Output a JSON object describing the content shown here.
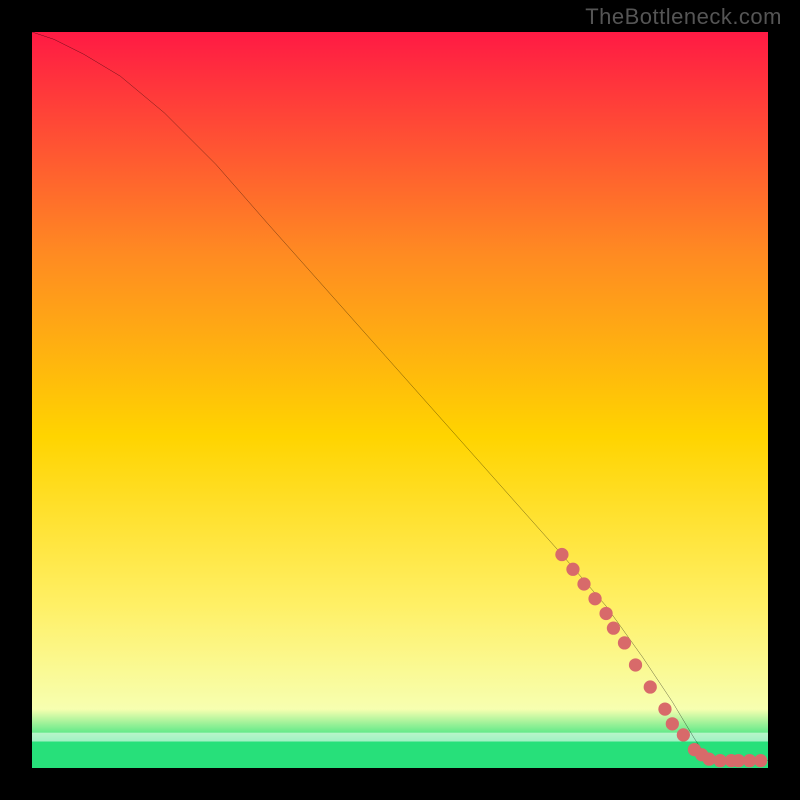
{
  "watermark": "TheBottleneck.com",
  "chart_data": {
    "type": "line",
    "title": "",
    "xlabel": "",
    "ylabel": "",
    "xlim": [
      0,
      100
    ],
    "ylim": [
      0,
      100
    ],
    "gradient_colors": {
      "top": "#ff1a44",
      "mid_upper": "#ff8a22",
      "mid": "#ffd400",
      "mid_lower": "#fff066",
      "lower": "#f7ffb0",
      "optimal": "#27e07a"
    },
    "series": [
      {
        "name": "bottleneck-curve",
        "stroke": "#000000",
        "x": [
          0,
          3,
          7,
          12,
          18,
          25,
          32,
          40,
          48,
          56,
          64,
          72,
          78,
          83,
          87,
          90,
          92,
          100
        ],
        "y": [
          100,
          99,
          97,
          94,
          89,
          82,
          74,
          65,
          56,
          47,
          38,
          29,
          22,
          15,
          9,
          4,
          1,
          1
        ]
      }
    ],
    "markers": {
      "name": "highlighted-region",
      "color": "#d86a6a",
      "radius": 6,
      "x": [
        72,
        73.5,
        75,
        76.5,
        78,
        79,
        80.5,
        82,
        84,
        86,
        87,
        88.5,
        90,
        91,
        92,
        93.5,
        95,
        96,
        97.5,
        99
      ],
      "y": [
        29,
        27,
        25,
        23,
        21,
        19,
        17,
        14,
        11,
        8,
        6,
        4.5,
        2.5,
        1.8,
        1.2,
        1,
        1,
        1,
        1,
        1
      ]
    }
  }
}
